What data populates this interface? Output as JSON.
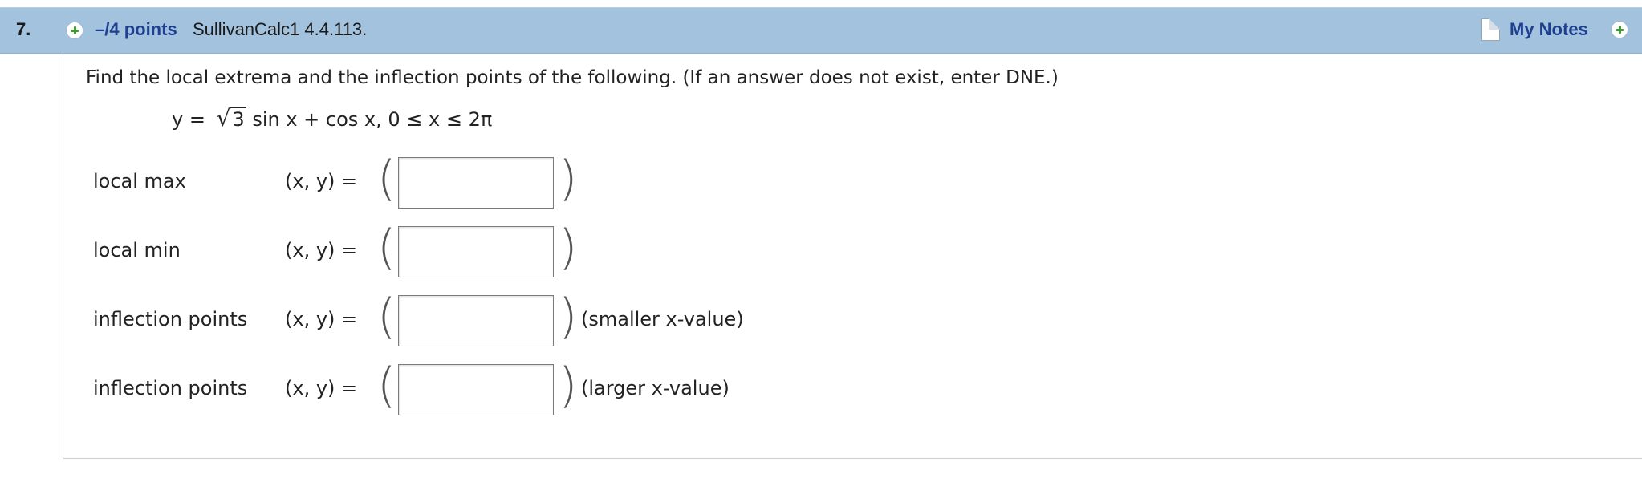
{
  "header": {
    "question_number": "7.",
    "points": "–/4 points",
    "source": "SullivanCalc1 4.4.113.",
    "my_notes": "My Notes"
  },
  "problem": {
    "prompt": "Find the local extrema and the inflection points of the following. (If an answer does not exist, enter DNE.)",
    "equation_lhs": "y = ",
    "equation_radicand": "3",
    "equation_rest": " sin x + cos x, 0 ≤ x ≤ 2π"
  },
  "rows": [
    {
      "label": "local max",
      "pair": "(x, y)  =",
      "value": "",
      "hint": ""
    },
    {
      "label": "local min",
      "pair": "(x, y)  =",
      "value": "",
      "hint": ""
    },
    {
      "label": "inflection points",
      "pair": "(x, y)  =",
      "value": "",
      "hint": "(smaller x-value)"
    },
    {
      "label": "inflection points",
      "pair": "(x, y)  =",
      "value": "",
      "hint": "(larger x-value)"
    }
  ],
  "colors": {
    "header_bg": "#a3c2de",
    "link_blue": "#1f3f8f",
    "plus_green": "#3f9b32"
  },
  "icons": [
    "plus-icon",
    "note-icon"
  ]
}
